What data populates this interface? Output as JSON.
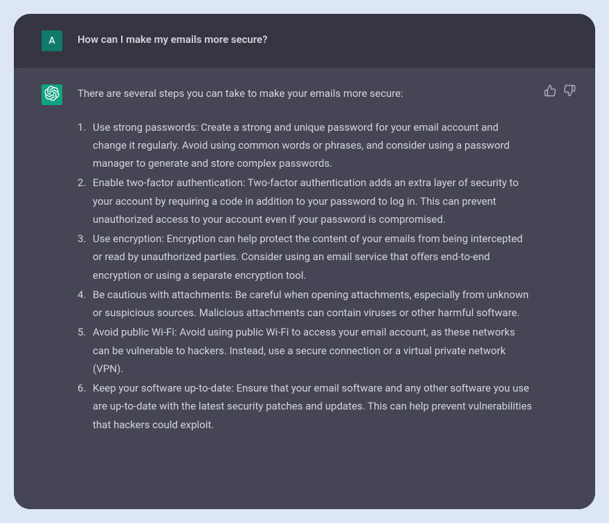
{
  "user": {
    "avatar_letter": "A",
    "message": "How can I make my emails more secure?"
  },
  "assistant": {
    "intro": "There are several steps you can take to make your emails more secure:",
    "items": [
      "Use strong passwords: Create a strong and unique password for your email account and change it regularly. Avoid using common words or phrases, and consider using a password manager to generate and store complex passwords.",
      "Enable two-factor authentication: Two-factor authentication adds an extra layer of security to your account by requiring a code in addition to your password to log in. This can prevent unauthorized access to your account even if your password is compromised.",
      "Use encryption: Encryption can help protect the content of your emails from being intercepted or read by unauthorized parties. Consider using an email service that offers end-to-end encryption or using a separate encryption tool.",
      "Be cautious with attachments: Be careful when opening attachments, especially from unknown or suspicious sources. Malicious attachments can contain viruses or other harmful software.",
      "Avoid public Wi-Fi: Avoid using public Wi-Fi to access your email account, as these networks can be vulnerable to hackers. Instead, use a secure connection or a virtual private network (VPN).",
      "Keep your software up-to-date: Ensure that your email software and any other software you use are up-to-date with the latest security patches and updates. This can help prevent vulnerabilities that hackers could exploit."
    ]
  }
}
